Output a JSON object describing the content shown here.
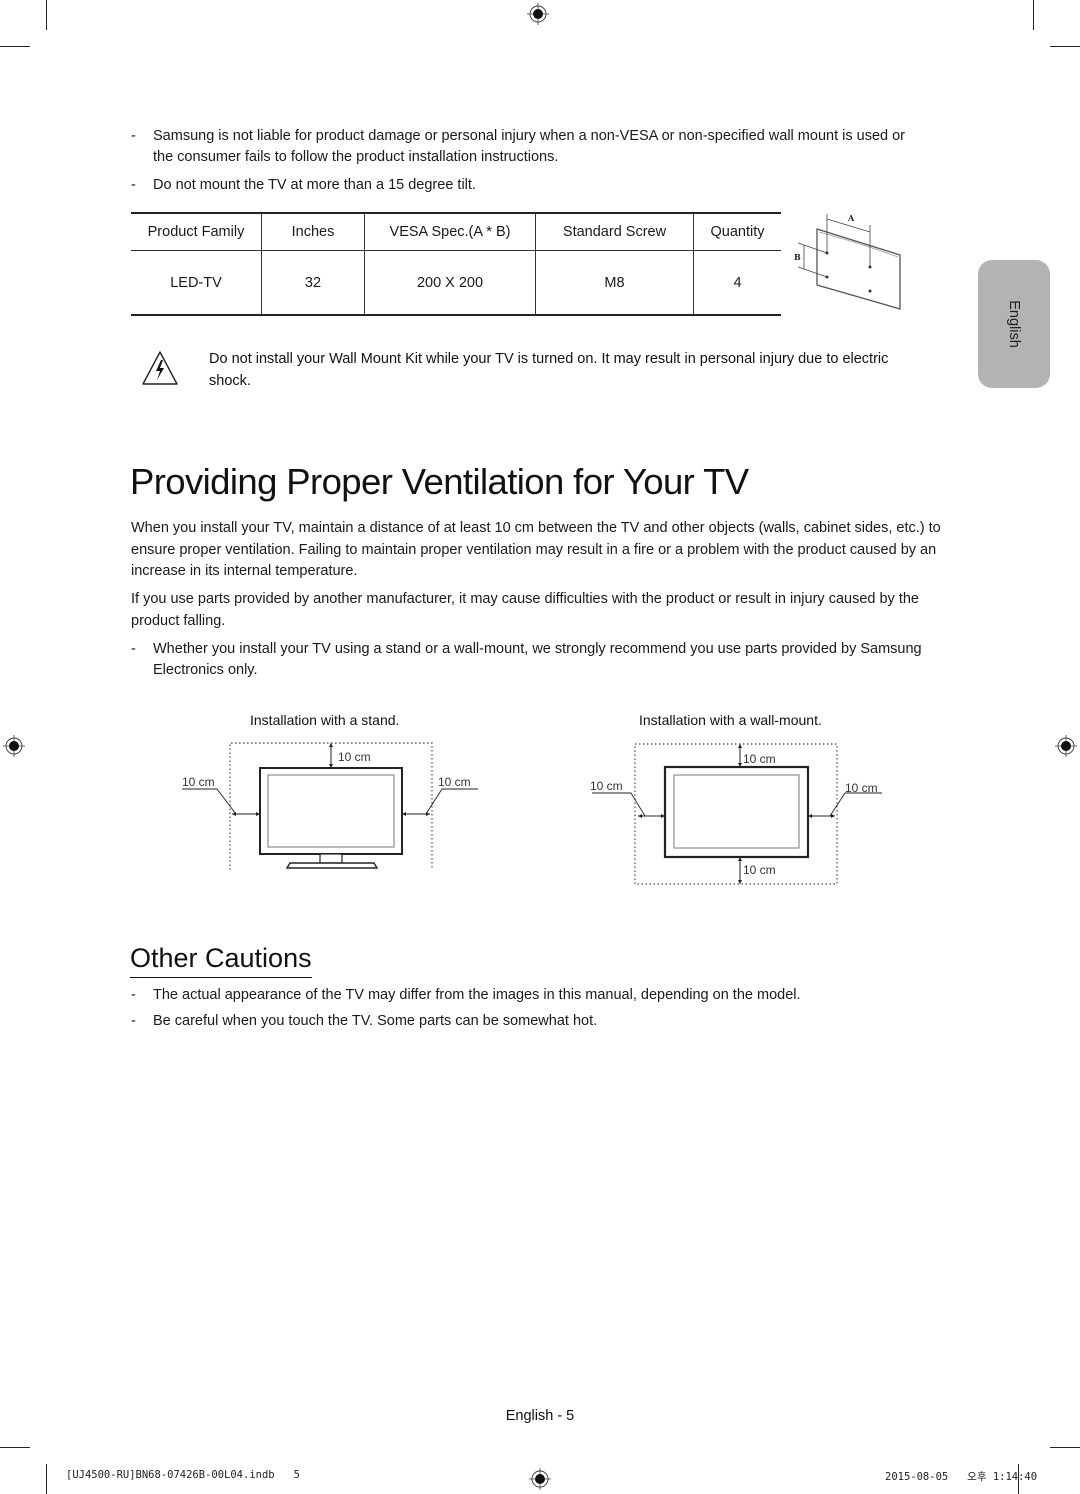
{
  "top_bullets": [
    {
      "dash": "-",
      "text_line1": "Samsung is not liable for product damage or personal injury when a non-VESA or non-specified wall mount is used or",
      "text_line2": "the consumer fails to follow the product installation instructions."
    },
    {
      "dash": "-",
      "text_line1": "Do not mount the TV at more than a 15 degree tilt."
    }
  ],
  "vesa_table": {
    "headers": [
      "Product Family",
      "Inches",
      "VESA Spec.(A * B)",
      "Standard Screw",
      "Quantity"
    ],
    "rows": [
      [
        "LED-TV",
        "32",
        "200 X 200",
        "M8",
        "4"
      ]
    ]
  },
  "mount_diagram": {
    "label_a": "A",
    "label_b": "B"
  },
  "language_tab": "English",
  "warning": {
    "icon": "electric-shock-warning-icon",
    "text": "Do not install your Wall Mount Kit while your TV is turned on. It may result in personal injury due to electric shock."
  },
  "ventilation": {
    "title": "Providing Proper Ventilation for Your TV",
    "paragraphs": [
      "When you install your TV, maintain a distance of at least 10 cm between the TV and other objects (walls, cabinet sides, etc.) to ensure proper ventilation. Failing to maintain proper ventilation may result in a fire or a problem with the product caused by an increase in its internal temperature.",
      "If you use parts provided by another manufacturer, it may cause difficulties with the product or result in injury caused by the product falling."
    ],
    "bullet": {
      "dash": "-",
      "text_line1": "Whether you install your TV using a stand or a wall-mount, we strongly recommend you use parts provided by Samsung",
      "text_line2": "Electronics only."
    },
    "stand_diagram": {
      "caption": "Installation with a stand.",
      "top": "10 cm",
      "left": "10 cm",
      "right": "10 cm"
    },
    "wall_diagram": {
      "caption": "Installation with a wall-mount.",
      "top": "10 cm",
      "left": "10 cm",
      "right": "10 cm",
      "bottom": "10 cm"
    }
  },
  "other_cautions": {
    "title": "Other Cautions",
    "bullets": [
      {
        "dash": "-",
        "text": "The actual appearance of the TV may differ from the images in this manual, depending on the model."
      },
      {
        "dash": "-",
        "text": "Be careful when you touch the TV. Some parts can be somewhat hot."
      }
    ]
  },
  "footer": {
    "page_label": "English - 5",
    "slug_file": "[UJ4500-RU]BN68-07426B-00L04.indb   5",
    "slug_date": "2015-08-05   오후 1:14:40"
  }
}
